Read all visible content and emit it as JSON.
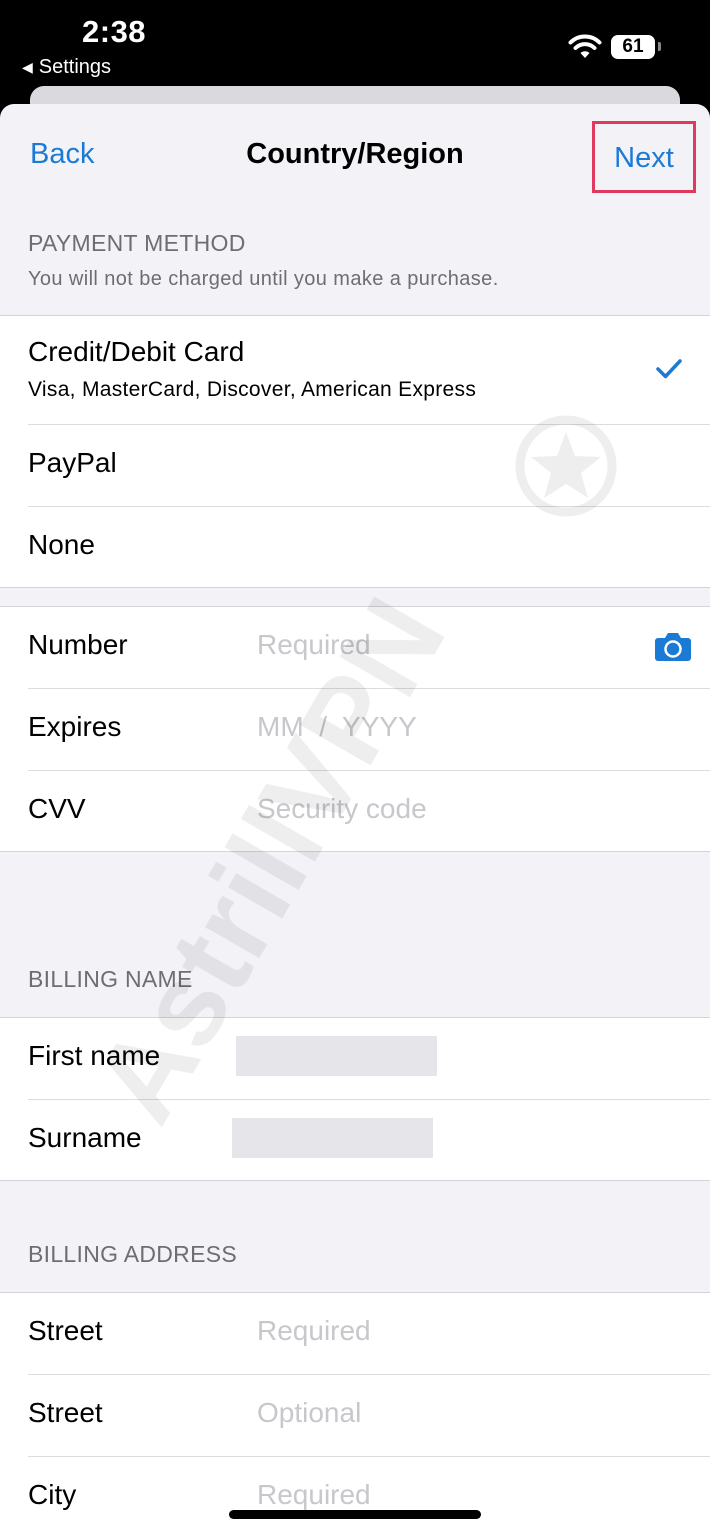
{
  "status_bar": {
    "time": "2:38",
    "back_app": "Settings",
    "battery_level": "61"
  },
  "nav": {
    "back_label": "Back",
    "title": "Country/Region",
    "next_label": "Next",
    "accent_color": "#1a7ad4",
    "highlight_color": "#e0385f"
  },
  "payment_method": {
    "header": "PAYMENT METHOD",
    "subheader": "You will not be charged until you make a purchase.",
    "options": [
      {
        "label": "Credit/Debit Card",
        "subtitle": "Visa, MasterCard, Discover, American Express",
        "selected": true
      },
      {
        "label": "PayPal",
        "selected": false
      },
      {
        "label": "None",
        "selected": false
      }
    ]
  },
  "card_fields": {
    "number": {
      "label": "Number",
      "placeholder": "Required"
    },
    "expires": {
      "label": "Expires",
      "placeholder": "MM  /  YYYY"
    },
    "cvv": {
      "label": "CVV",
      "placeholder": "Security code"
    }
  },
  "billing_name": {
    "header": "BILLING NAME",
    "first_name": {
      "label": "First name",
      "value": ""
    },
    "surname": {
      "label": "Surname",
      "value": ""
    }
  },
  "billing_address": {
    "header": "BILLING ADDRESS",
    "street1": {
      "label": "Street",
      "placeholder": "Required"
    },
    "street2": {
      "label": "Street",
      "placeholder": "Optional"
    },
    "city": {
      "label": "City",
      "placeholder": "Required"
    }
  },
  "watermark": "AstrillVPN"
}
